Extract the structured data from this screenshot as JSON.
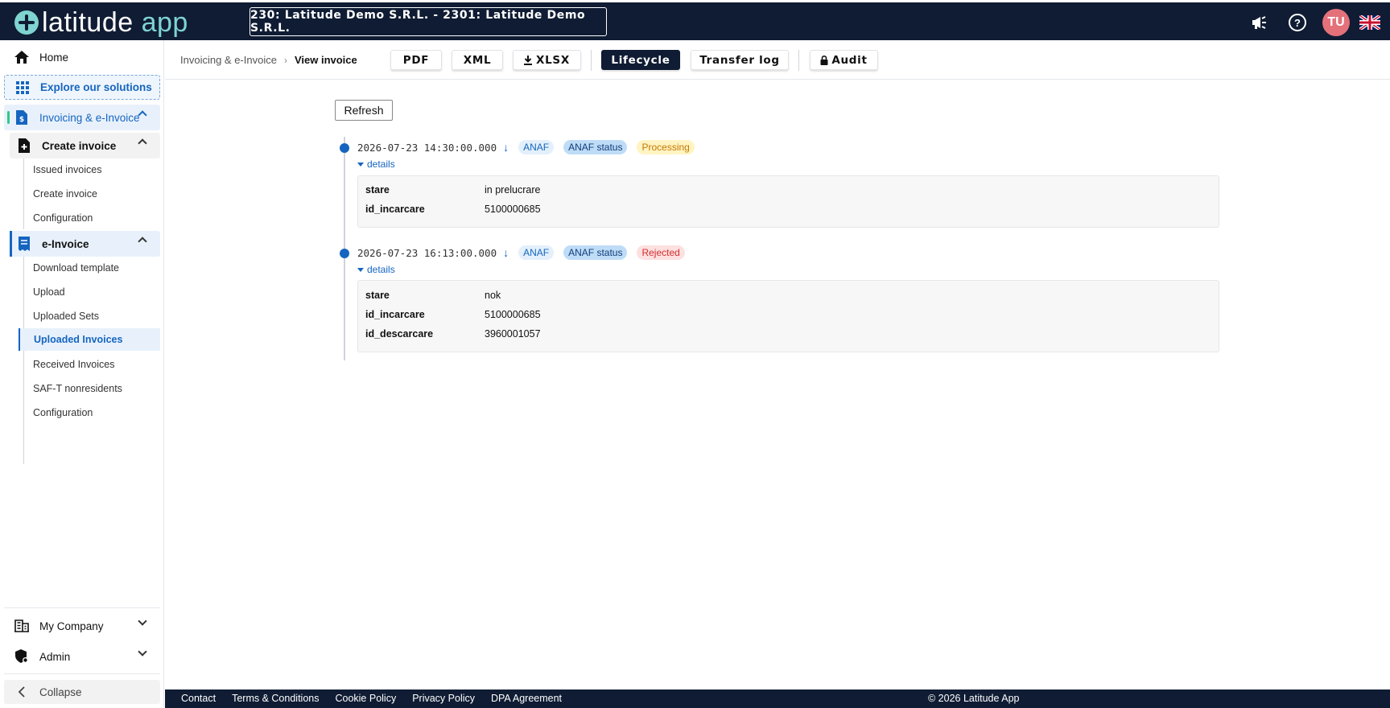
{
  "topbar": {
    "logo_primary": "latitude",
    "logo_accent": " app",
    "company": "230: Latitude Demo S.R.L. - 2301: Latitude Demo S.R.L.",
    "avatar_initials": "TU",
    "icons": [
      "megaphone-icon",
      "help-icon",
      "uk-flag-icon"
    ]
  },
  "sidebar": {
    "home": "Home",
    "explore": "Explore our solutions",
    "invoicing": "Invoicing & e-Invoice",
    "create_invoice_group": "Create invoice",
    "create_invoice_items": [
      "Issued invoices",
      "Create invoice",
      "Configuration"
    ],
    "einvoice_group": "e-Invoice",
    "einvoice_items": [
      "Download template",
      "Upload",
      "Uploaded Sets",
      "Uploaded Invoices",
      "Received Invoices",
      "SAF-T nonresidents",
      "Configuration"
    ],
    "active_item": "Uploaded Invoices",
    "my_company": "My Company",
    "admin": "Admin",
    "collapse": "Collapse"
  },
  "header": {
    "breadcrumb_parent": "Invoicing & e-Invoice",
    "breadcrumb_current": "View invoice",
    "buttons": {
      "pdf": "PDF",
      "xml": "XML",
      "xlsx": "XLSX",
      "lifecycle": "Lifecycle",
      "transfer_log": "Transfer log",
      "audit": "Audit"
    },
    "active_tab": "Lifecycle"
  },
  "main": {
    "refresh": "Refresh",
    "details_label": "details",
    "arrow": "↓",
    "entries": [
      {
        "timestamp": "2026-07-23 14:30:00.000",
        "source": "ANAF",
        "type": "ANAF status",
        "status": "Processing",
        "status_color": "#c77800",
        "fields": [
          {
            "key": "stare",
            "value": "in prelucrare"
          },
          {
            "key": "id_incarcare",
            "value": "5100000685"
          }
        ]
      },
      {
        "timestamp": "2026-07-23 16:13:00.000",
        "source": "ANAF",
        "type": "ANAF status",
        "status": "Rejected",
        "status_color": "#d32f2f",
        "fields": [
          {
            "key": "stare",
            "value": "nok"
          },
          {
            "key": "id_incarcare",
            "value": "5100000685"
          },
          {
            "key": "id_descarcare",
            "value": "3960001057"
          }
        ]
      }
    ]
  },
  "footer": {
    "links": [
      "Contact",
      "Terms & Conditions",
      "Cookie Policy",
      "Privacy Policy",
      "DPA Agreement"
    ],
    "copyright": "© 2026 Latitude App"
  },
  "colors": {
    "navy": "#0f1c33",
    "accent_teal": "#7fd3d0",
    "link_blue": "#1565c0"
  }
}
